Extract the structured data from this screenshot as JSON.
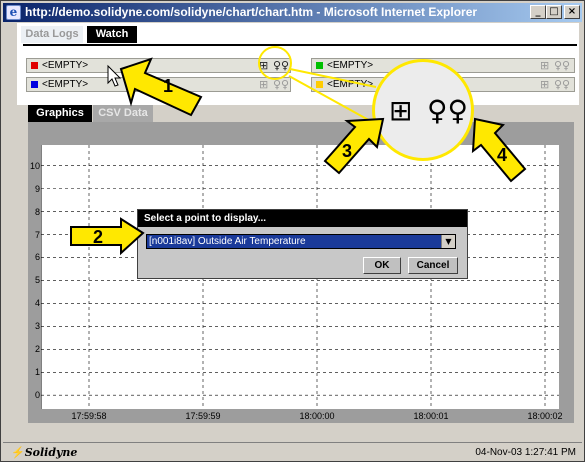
{
  "window": {
    "title": "http://demo.solidyne.com/solidyne/chart/chart.htm - Microsoft Internet Explorer",
    "minimize": "_",
    "maximize": "□",
    "close": "×"
  },
  "top_tabs": [
    {
      "label": "Data Logs",
      "active": false
    },
    {
      "label": "Watch",
      "active": true
    }
  ],
  "watch_slots": [
    {
      "label": "<EMPTY>",
      "color": "#e00000"
    },
    {
      "label": "<EMPTY>",
      "color": "#0000e0"
    },
    {
      "label": "<EMPTY>",
      "color": "#00c000"
    },
    {
      "label": "<EMPTY>",
      "color": "#ffcc00"
    }
  ],
  "slot_icons": [
    "table-icon",
    "glasses-icon"
  ],
  "panel_tabs": [
    {
      "label": "Graphics",
      "active": true
    },
    {
      "label": "CSV Data",
      "active": false
    }
  ],
  "chart_data": {
    "type": "line",
    "title": "",
    "xlabel": "",
    "ylabel": "",
    "yticks": [
      0,
      1,
      2,
      3,
      4,
      5,
      6,
      7,
      8,
      9,
      10
    ],
    "ylim": [
      -0.6,
      10.9
    ],
    "xticks": [
      "17:59:58",
      "17:59:59",
      "18:00:00",
      "18:00:01",
      "18:00:02"
    ],
    "grid": true,
    "series": []
  },
  "dialog": {
    "title": "Select a point to display...",
    "selected_option": "[n001i8av] Outside Air Temperature",
    "ok_label": "OK",
    "cancel_label": "Cancel"
  },
  "status": {
    "logo": "Solidyne",
    "timestamp": "04-Nov-03 1:27:41 PM"
  },
  "annotations": {
    "callouts": [
      "1",
      "2",
      "3",
      "4"
    ],
    "highlight_color": "#ffe800"
  }
}
